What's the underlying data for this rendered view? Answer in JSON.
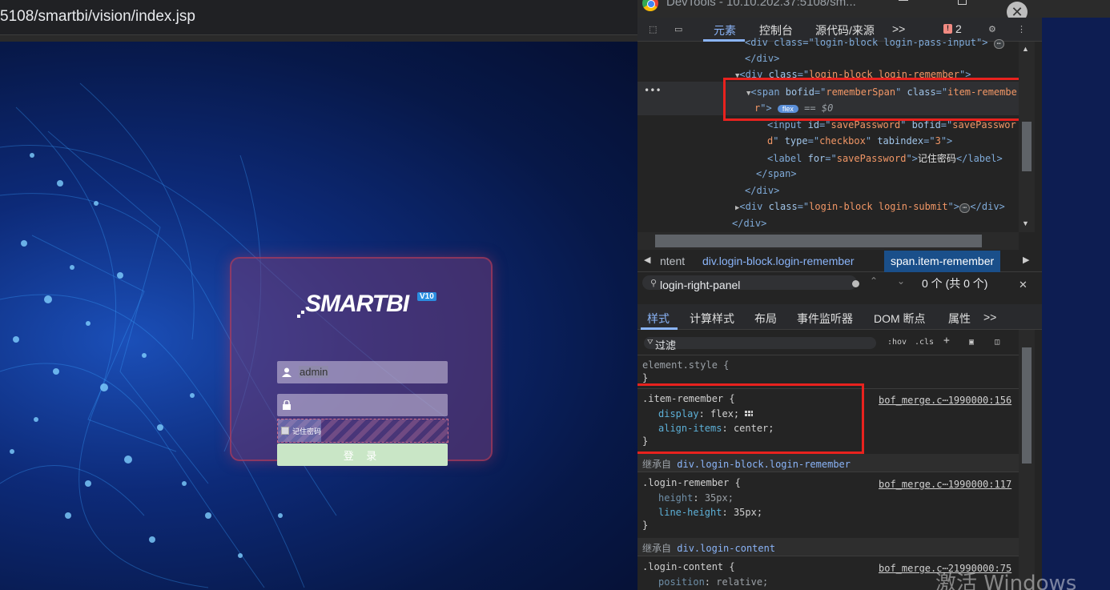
{
  "browser": {
    "url_visible": "5108/smartbi/vision/index.jsp"
  },
  "login": {
    "logo_text": "SMARTBI",
    "version_badge": "V10",
    "username_value": "admin",
    "remember_label": "记住密码",
    "submit_label": "登 录"
  },
  "devtools": {
    "window_title": "DevTools - 10.10.202.37:5108/sm...",
    "tabs": [
      "元素",
      "控制台",
      "源代码/来源"
    ],
    "more_tabs": ">>",
    "issues_count": "2",
    "dom_lines": {
      "l1_open": "<div class=\"login-block login-pass-input\">",
      "l2": "</div>",
      "l3_tag": "div",
      "l3_class_attr": "class",
      "l3_class_val": "login-block login-remember",
      "l4_tag": "span",
      "l4_attr1": "bofid",
      "l4_val1": "rememberSpan",
      "l4_attr2": "class",
      "l4_val2a": "item-remembe",
      "l4_val2b": "r",
      "flex_badge": "flex",
      "eq_sel": "== $0",
      "l5_tag": "input",
      "l5_attr1": "id",
      "l5_val1": "savePassword",
      "l5_attr2": "bofid",
      "l5_val2a": "savePasswor",
      "l5_val2b": "d",
      "l5_attr3": "type",
      "l5_val3": "checkbox",
      "l5_attr4": "tabindex",
      "l5_val4": "3",
      "l6_tag": "label",
      "l6_attr": "for",
      "l6_val": "savePassword",
      "l6_text": "记住密码",
      "l7": "</span>",
      "l8": "</div>",
      "l9_tag": "div",
      "l9_class_val": "login-block login-submit",
      "l10": "</div>"
    },
    "breadcrumb": [
      "ntent",
      "div.login-block.login-remember",
      "span.item-remember"
    ],
    "search": {
      "query": "login-right-panel",
      "result": "0 个 (共 0 个)"
    },
    "style_tabs": [
      "样式",
      "计算样式",
      "布局",
      "事件监听器",
      "DOM 断点",
      "属性"
    ],
    "filter_label": "过滤",
    "filter_tools": [
      ":hov",
      ".cls",
      "+"
    ],
    "styles": {
      "element_style": "element.style {",
      "rule1_selector": ".item-remember {",
      "rule1_source": "bof_merge.c⋯1990000:156",
      "rule1_props": [
        {
          "name": "display",
          "value": "flex;"
        },
        {
          "name": "align-items",
          "value": "center;"
        }
      ],
      "inherited1_label": "继承自",
      "inherited1_sel": "div.login-block.login-remember",
      "rule2_selector": ".login-remember {",
      "rule2_source": "bof_merge.c⋯1990000:117",
      "rule2_props": [
        {
          "name": "height",
          "value": "35px;"
        },
        {
          "name": "line-height",
          "value": "35px;"
        }
      ],
      "inherited2_label": "继承自",
      "inherited2_sel": "div.login-content",
      "rule3_selector": ".login-content {",
      "rule3_source": "bof_merge.c⋯21990000:75",
      "rule3_props": [
        {
          "name": "position",
          "value": "relative;"
        }
      ],
      "close_brace": "}"
    }
  },
  "watermark": "激活 Windows",
  "colors": {
    "highlight_red": "#e8221e",
    "devtools_bg": "#242424",
    "accent_blue": "#8ab4f8",
    "submit_green": "#c9e6c6"
  }
}
